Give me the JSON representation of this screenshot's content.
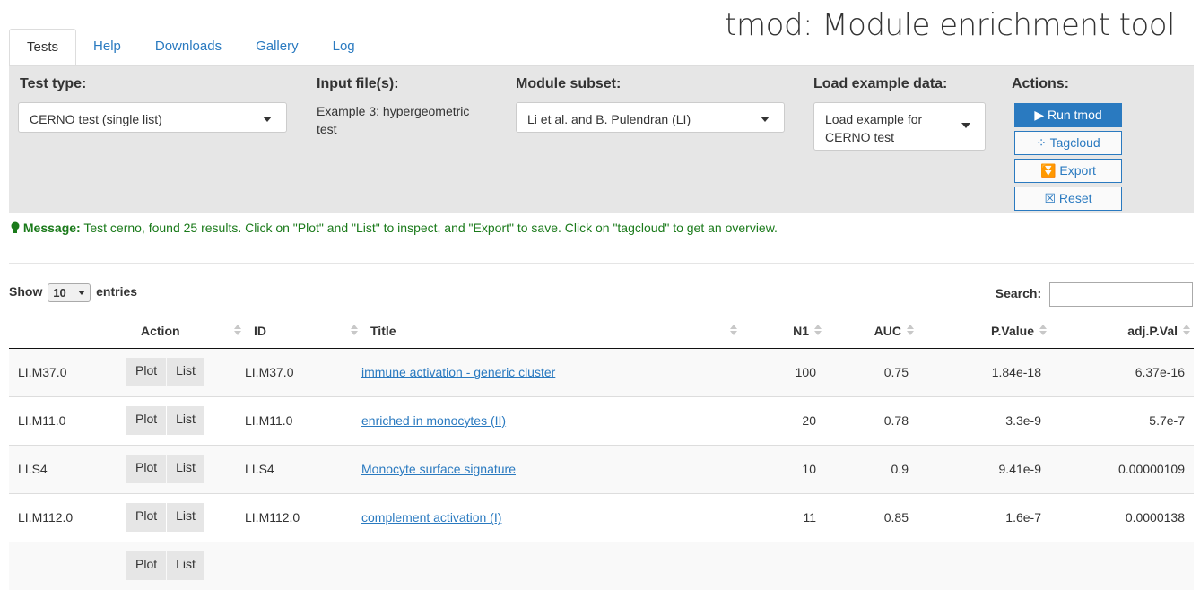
{
  "app": {
    "title": "tmod: Module enrichment tool"
  },
  "tabs": [
    {
      "label": "Tests",
      "active": true
    },
    {
      "label": "Help"
    },
    {
      "label": "Downloads"
    },
    {
      "label": "Gallery"
    },
    {
      "label": "Log"
    }
  ],
  "panel": {
    "test_type": {
      "label": "Test type:",
      "value": "CERNO test (single list)"
    },
    "input_files": {
      "label": "Input file(s):",
      "value": "Example 3: hypergeometric test"
    },
    "module_subset": {
      "label": "Module subset:",
      "value": "Li et al. and B. Pulendran (LI)"
    },
    "load_example": {
      "label": "Load example data:",
      "value": "Load example for CERNO test"
    },
    "actions": {
      "label": "Actions:",
      "run": "▶ Run tmod",
      "tagcloud": "⁘ Tagcloud",
      "export": "⏬ Export",
      "reset": "☒ Reset"
    }
  },
  "message": {
    "prefix": "Message:",
    "text": "Test cerno, found 25 results. Click on \"Plot\" and \"List\" to inspect, and \"Export\" to save. Click on \"tagcloud\" to get an overview."
  },
  "table_controls": {
    "show": "Show",
    "length_value": "10",
    "entries": "entries",
    "search_label": "Search:"
  },
  "table": {
    "columns": [
      "",
      "Action",
      "ID",
      "Title",
      "N1",
      "AUC",
      "P.Value",
      "adj.P.Val"
    ],
    "plot_label": "Plot",
    "list_label": "List",
    "rows": [
      {
        "rowname": "LI.M37.0",
        "id": "LI.M37.0",
        "title": "immune activation - generic cluster",
        "n1": "100",
        "auc": "0.75",
        "pvalue": "1.84e-18",
        "adjp": "6.37e-16"
      },
      {
        "rowname": "LI.M11.0",
        "id": "LI.M11.0",
        "title": "enriched in monocytes (II)",
        "n1": "20",
        "auc": "0.78",
        "pvalue": "3.3e-9",
        "adjp": "5.7e-7"
      },
      {
        "rowname": "LI.S4",
        "id": "LI.S4",
        "title": "Monocyte surface signature",
        "n1": "10",
        "auc": "0.9",
        "pvalue": "9.41e-9",
        "adjp": "0.00000109"
      },
      {
        "rowname": "LI.M112.0",
        "id": "LI.M112.0",
        "title": "complement activation (I)",
        "n1": "11",
        "auc": "0.85",
        "pvalue": "1.6e-7",
        "adjp": "0.0000138"
      },
      {
        "rowname": "",
        "id": "",
        "title": "",
        "n1": "",
        "auc": "",
        "pvalue": "",
        "adjp": ""
      }
    ]
  },
  "colors": {
    "accent": "#2a7ac0",
    "panel_bg": "#e6e6e6",
    "message": "#1a7a1a"
  }
}
